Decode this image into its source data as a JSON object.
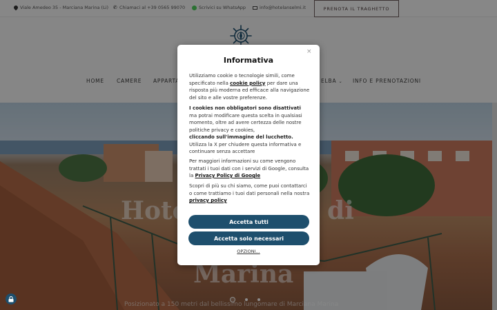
{
  "topbar": {
    "address": "Viale Amedeo 35 - Marciana Marina (Li)",
    "phone": "Chiamaci al +39 0565 99070",
    "whatsapp": "Scrivici su WhatsApp",
    "email": "info@hotelanselmi.it",
    "ferry_button": "PRENOTA IL TRAGHETTO"
  },
  "nav": {
    "items": [
      "HOME",
      "CAMERE",
      "APPARTA",
      "ELBA",
      "INFO E PRENOTAZIONI"
    ]
  },
  "hero": {
    "title_line1": "Hotel Anselmi di",
    "title_line2": "Marina",
    "subtitle": "Posizionato a 150 metri dal bellissimo lungomare di Marciana Marina",
    "slides": 3,
    "active_slide": 1
  },
  "modal": {
    "title": "Informativa",
    "close": "×",
    "p1_a": "Utilizziamo cookie o tecnologie simili, come specificato nella ",
    "p1_link": "cookie policy",
    "p1_b": " per dare una risposta più moderna ed efficace alla navigazione del sito e alle vostre preferenze.",
    "p2_bold": "I cookies non obbligatori sono disattivati",
    "p2_a": " ma potrai modificare questa scelta in qualsiasi momento, oltre ad avere certezza delle nostre politiche privacy e cookies,",
    "p2_bold2": "cliccando sull'immagine del lucchetto.",
    "p2_b": " Utilizza la X per chiudere questa informativa e continuare senza accettare",
    "p3_a": "Per maggiori informazioni su come vengono trattati i tuoi dati con i servizi di Google, consulta la ",
    "p3_link": "Privacy Policy di Google",
    "p4_a": "Scopri di più su chi siamo, come puoi contattarci o come trattiamo i tuoi dati personali nella nostra ",
    "p4_link": "privacy policy",
    "accept_all": "Accetta tutti",
    "accept_necessary": "Accetta solo necessari",
    "options": "OPZIONI..."
  },
  "colors": {
    "primary": "#1e4f6d",
    "whatsapp": "#4fce5d"
  },
  "icons": [
    "map-pin-icon",
    "phone-icon",
    "whatsapp-icon",
    "mail-icon",
    "compass-logo",
    "lock-icon",
    "close-icon",
    "chevron-down-icon"
  ]
}
